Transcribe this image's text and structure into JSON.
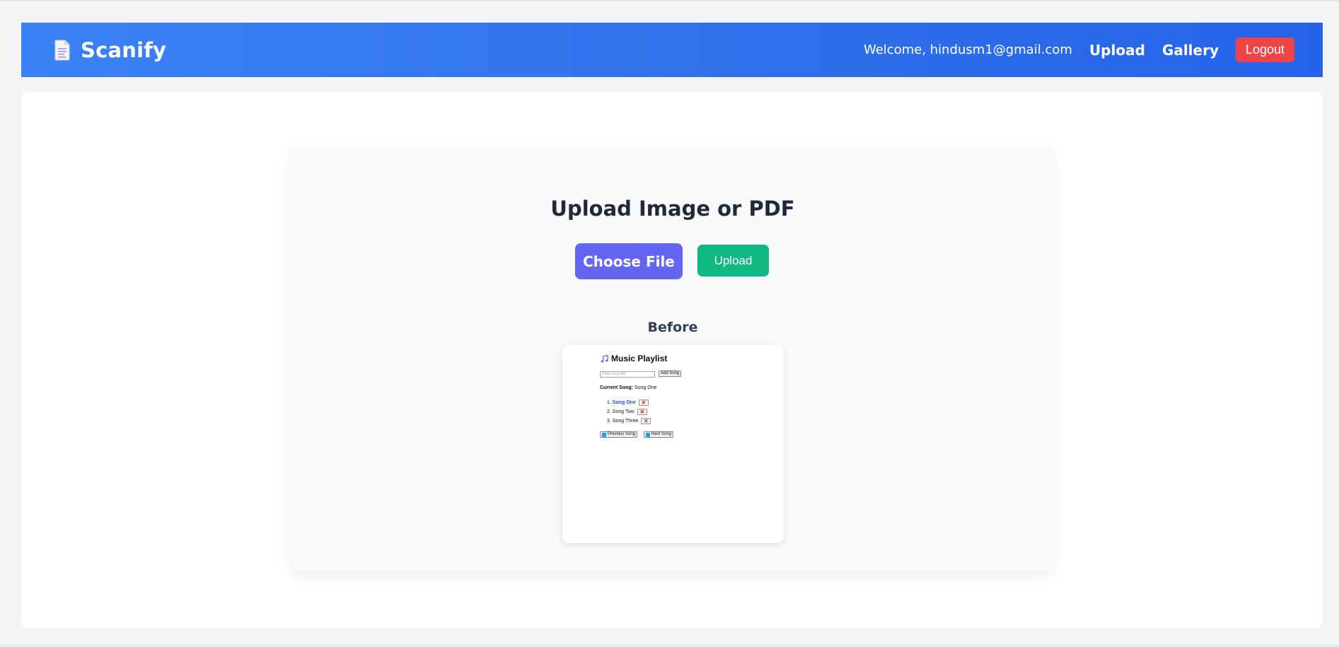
{
  "app": {
    "name": "Scanify",
    "logo_icon": "document-icon"
  },
  "nav": {
    "welcome": "Welcome, hindusm1@gmail.com",
    "links": [
      "Upload",
      "Gallery"
    ],
    "logout_label": "Logout"
  },
  "upload_card": {
    "title": "Upload Image or PDF",
    "choose_label": "Choose File",
    "upload_label": "Upload",
    "before_label": "Before"
  },
  "preview": {
    "title": "Music Playlist",
    "title_icon": "music-note-icon",
    "input_placeholder": "Enter song title",
    "add_label": "Add Song",
    "current_label": "Current Song:",
    "current_value": "Song One",
    "songs": [
      {
        "num": "1.",
        "title": "Song One"
      },
      {
        "num": "2.",
        "title": "Song Two"
      },
      {
        "num": "3.",
        "title": "Song Three"
      }
    ],
    "remove_glyph": "✕",
    "prev_label": "Previous Song",
    "next_label": "Next Song"
  },
  "colors": {
    "nav_start": "#3b82f6",
    "nav_end": "#2563eb",
    "logout": "#ef4444",
    "choose": "#6366f1",
    "upload": "#10b981",
    "active_song": "#1d4ed8"
  }
}
